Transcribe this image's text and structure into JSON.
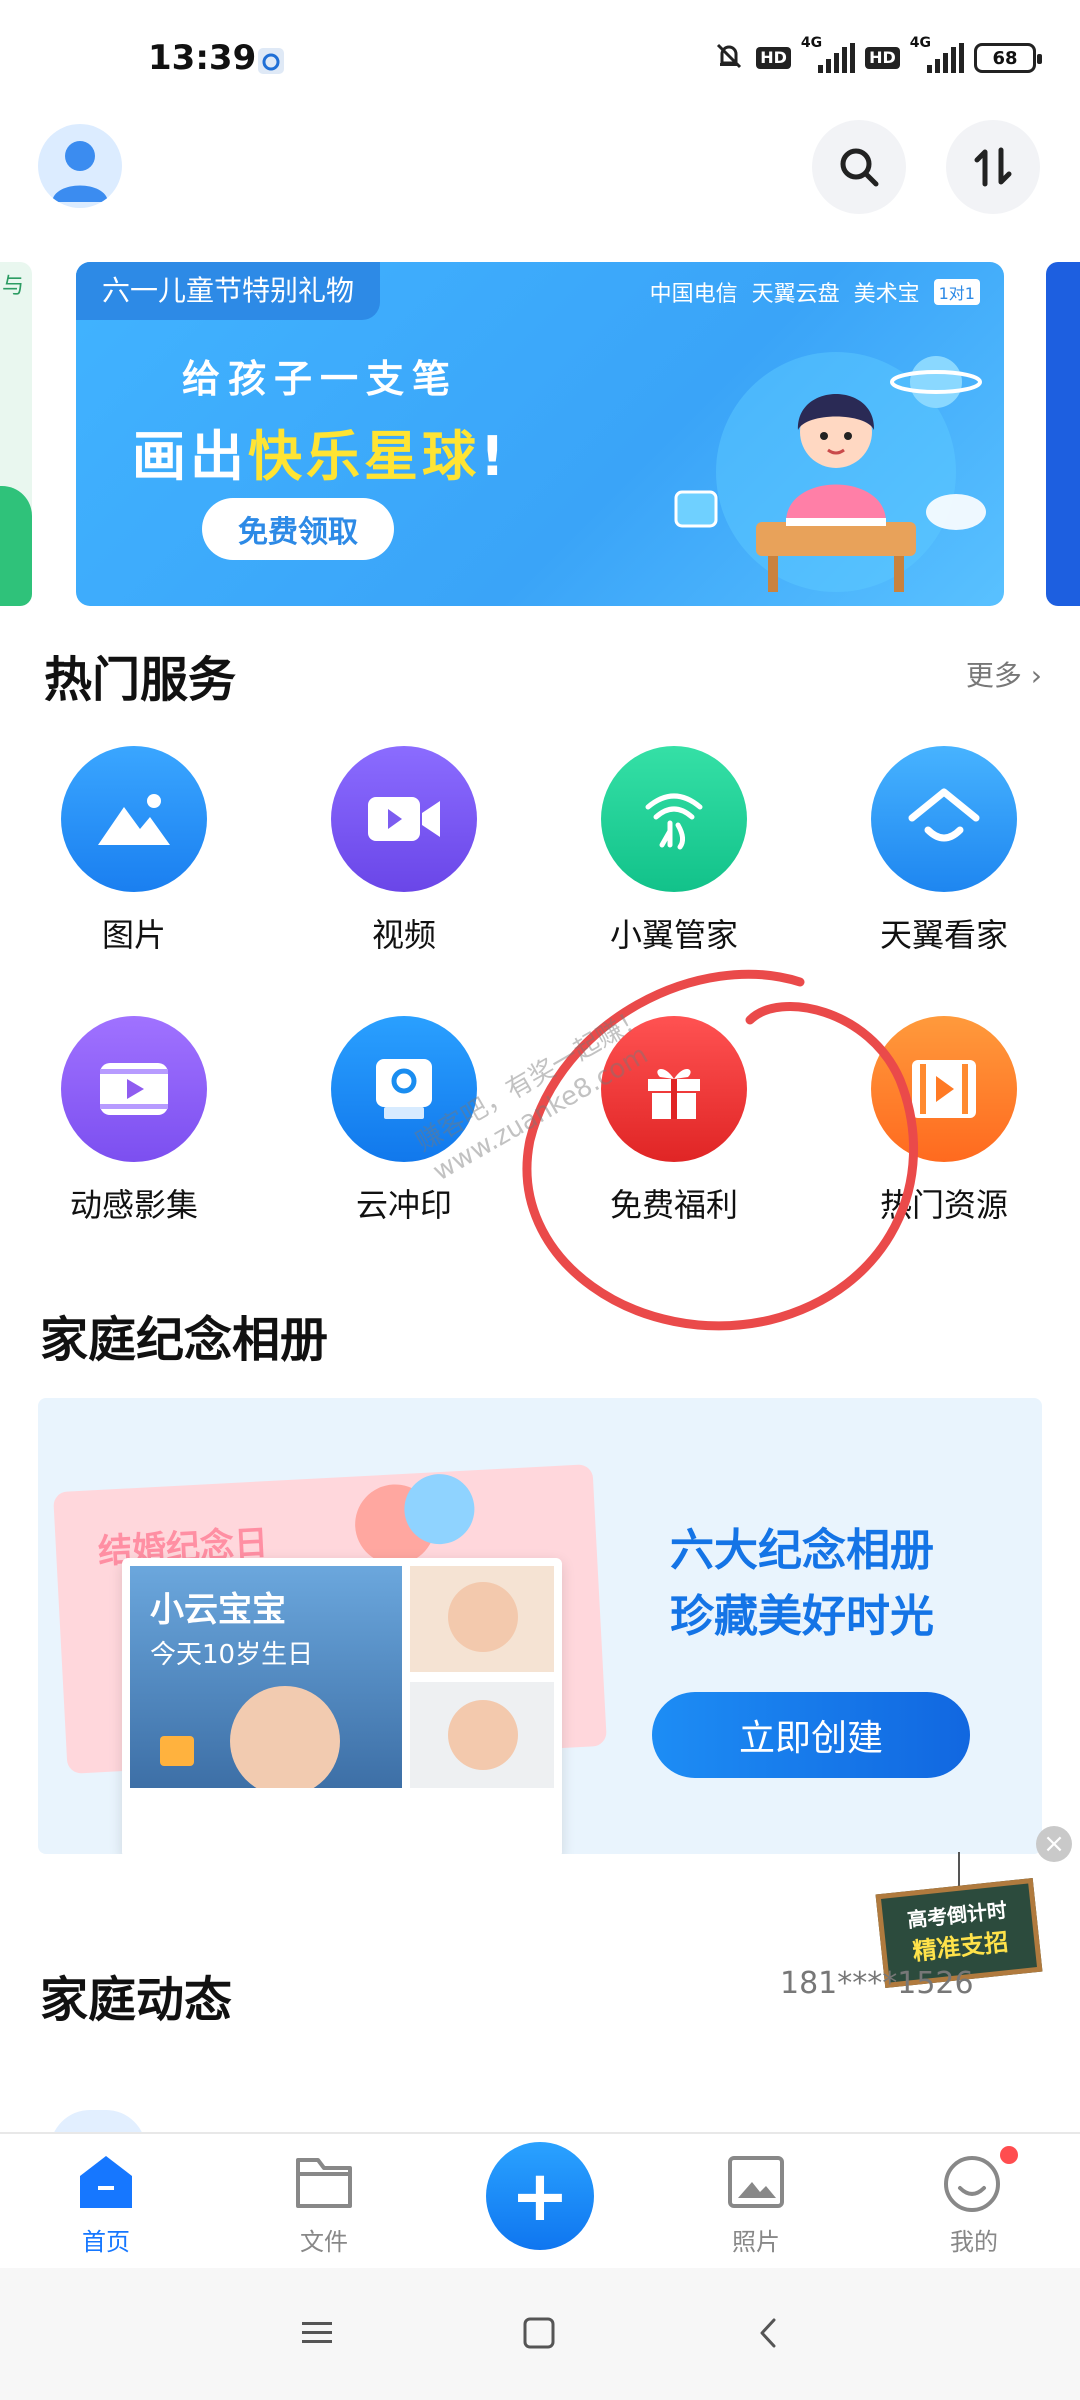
{
  "status_bar": {
    "time": "13:39",
    "hd1": "HD",
    "net1": "4G",
    "hd2": "HD",
    "net2": "4G",
    "battery": "68"
  },
  "banner": {
    "tag": "六一儿童节特别礼物",
    "brands": [
      "中国电信",
      "天翼云盘",
      "美术宝"
    ],
    "brand_badge": "1对1",
    "line1": "给孩子一支笔",
    "line2_prefix": "画出",
    "line2_highlight": "快乐星球",
    "line2_suffix": "!",
    "button": "免费领取",
    "left_peek_text": "与"
  },
  "hot_services": {
    "title": "热门服务",
    "more": "更多 ›",
    "items": [
      {
        "label": "图片",
        "icon": "image-icon",
        "color": "#1f8cf5"
      },
      {
        "label": "视频",
        "icon": "video-camera-icon",
        "color": "#7c5cf0"
      },
      {
        "label": "小翼管家",
        "icon": "wifi-signal-icon",
        "color": "#1fcf9a"
      },
      {
        "label": "天翼看家",
        "icon": "home-smile-icon",
        "color": "#2a9af5"
      },
      {
        "label": "动感影集",
        "icon": "film-album-icon",
        "color": "#8f5cf0"
      },
      {
        "label": "云冲印",
        "icon": "printer-icon",
        "color": "#1a8df0"
      },
      {
        "label": "免费福利",
        "icon": "gift-icon",
        "color": "#f03a3a"
      },
      {
        "label": "热门资源",
        "icon": "film-play-icon",
        "color": "#ff7a24"
      }
    ]
  },
  "family_album": {
    "title": "家庭纪念相册",
    "back_card": "结婚纪念日",
    "front_card_title": "小云宝宝",
    "front_card_sub": "今天10岁生日",
    "slogan1": "六大纪念相册",
    "slogan2": "珍藏美好时光",
    "button": "立即创建"
  },
  "ad": {
    "line1": "高考倒计时",
    "line2": "精准支招",
    "close": "×"
  },
  "family_feed": {
    "title": "家庭动态",
    "phone": "181****1526"
  },
  "bottom_nav": {
    "items": [
      {
        "label": "首页",
        "icon": "home-icon",
        "active": true
      },
      {
        "label": "文件",
        "icon": "folder-icon"
      },
      {
        "label": "照片",
        "icon": "photo-icon"
      },
      {
        "label": "我的",
        "icon": "smile-profile-icon"
      }
    ],
    "fab": "+"
  },
  "watermark": {
    "line1": "赚客吧，有奖一起赚！",
    "line2": "www.zuanke8.com"
  }
}
